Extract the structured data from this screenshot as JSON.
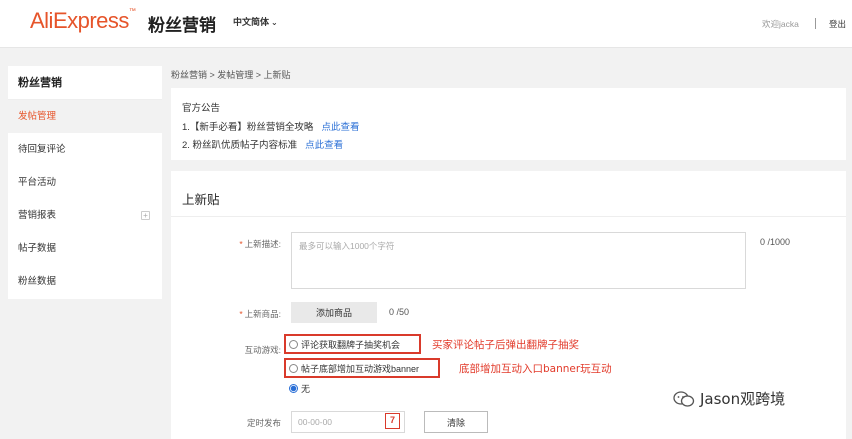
{
  "header": {
    "logo": "AliExpress",
    "logo_tm": "™",
    "subtitle": "粉丝营销",
    "language": "中文简体",
    "welcome": "欢迎jacka",
    "separator": "|",
    "logout": "登出"
  },
  "sidebar": {
    "title": "粉丝营销",
    "items": [
      {
        "label": "发帖管理"
      },
      {
        "label": "待回复评论"
      },
      {
        "label": "平台活动"
      },
      {
        "label": "营销报表"
      },
      {
        "label": "帖子数据"
      },
      {
        "label": "粉丝数据"
      }
    ]
  },
  "breadcrumb": "粉丝营销 > 发帖管理 > 上新贴",
  "notice": {
    "title": "官方公告",
    "lines": [
      {
        "text": "1.【新手必看】粉丝营销全攻略",
        "link": "点此查看"
      },
      {
        "text": "2. 粉丝趴优质帖子内容标准",
        "link": "点此查看"
      }
    ]
  },
  "form": {
    "title": "上新贴",
    "description": {
      "label": "上新描述:",
      "placeholder": "最多可以输入1000个字符",
      "count": "0 /1000"
    },
    "goods": {
      "label": "上新商品:",
      "button": "添加商品",
      "count": "0 /50"
    },
    "game": {
      "label": "互动游戏:",
      "options": [
        {
          "label": "评论获取翻牌子抽奖机会",
          "annotation": "买家评论帖子后弹出翻牌子抽奖"
        },
        {
          "label": "帖子底部增加互动游戏banner",
          "annotation": "底部增加互动入口banner玩互动"
        },
        {
          "label": "无"
        }
      ]
    },
    "schedule": {
      "label": "定时发布",
      "placeholder": "00-00-00",
      "calendar_glyph": "7",
      "clear_button": "清除"
    }
  },
  "watermark": "Jason观跨境",
  "colors": {
    "brand": "#e6542a",
    "link": "#2a6fd6",
    "highlight": "#d93a2b"
  }
}
